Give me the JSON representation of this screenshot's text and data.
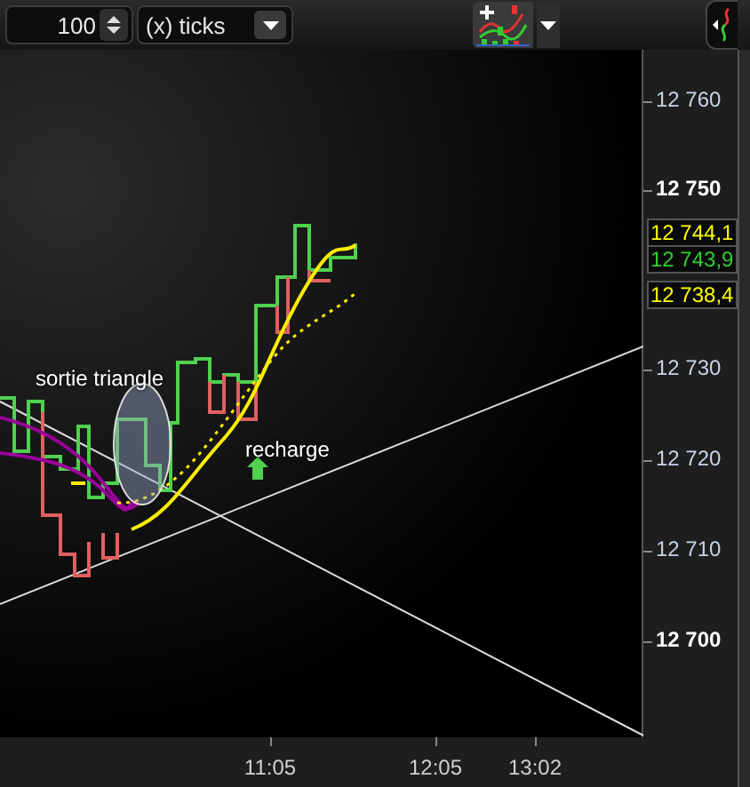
{
  "toolbar": {
    "quantity": "100",
    "interval_unit": "(x) ticks"
  },
  "annotations": [
    {
      "text": "sortie triangle",
      "kind": "label"
    },
    {
      "text": "recharge",
      "kind": "arrow-label"
    }
  ],
  "price_axis": {
    "labels": [
      {
        "text": "12 760",
        "major": false
      },
      {
        "text": "12 750",
        "major": true
      },
      {
        "text": "12 730",
        "major": false
      },
      {
        "text": "12 720",
        "major": false
      },
      {
        "text": "12 710",
        "major": false
      },
      {
        "text": "12 700",
        "major": true
      }
    ],
    "price_tags": [
      {
        "text": "12 744,1",
        "color": "#ffff00"
      },
      {
        "text": "12 743,9",
        "color": "#33cc33"
      },
      {
        "text": "12 738,4",
        "color": "#ffff00"
      }
    ]
  },
  "time_axis": {
    "labels": [
      "11:05",
      "12:05",
      "13:02"
    ]
  }
}
